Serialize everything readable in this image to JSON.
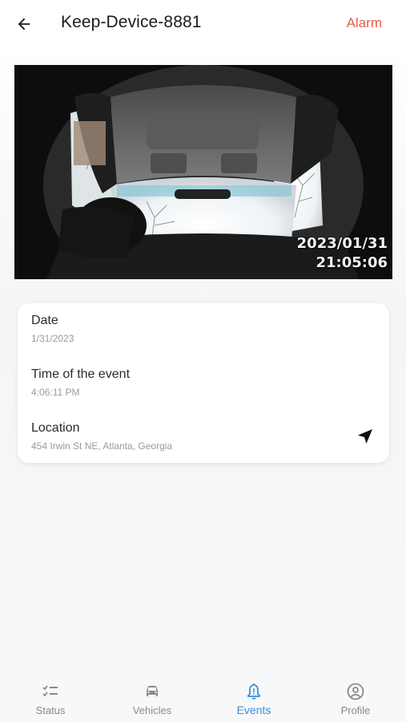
{
  "header": {
    "title": "Keep-Device-8881",
    "alarm_label": "Alarm"
  },
  "video": {
    "date": "2023/01/31",
    "time": "21:05:06"
  },
  "details": {
    "date_label": "Date",
    "date_value": "1/31/2023",
    "time_label": "Time of the event",
    "time_value": "4:06:11 PM",
    "location_label": "Location",
    "location_value": "454 Irwin St NE, Atlanta, Georgia"
  },
  "bottom_nav": {
    "items": [
      {
        "label": "Status",
        "icon": "checklist-icon"
      },
      {
        "label": "Vehicles",
        "icon": "car-icon"
      },
      {
        "label": "Events",
        "icon": "bell-alert-icon",
        "active": true
      },
      {
        "label": "Profile",
        "icon": "account-circle-icon"
      }
    ]
  },
  "colors": {
    "accent": "#3d8fdc",
    "alarm": "#ec5a4b",
    "inactive": "#8a8a8a"
  }
}
